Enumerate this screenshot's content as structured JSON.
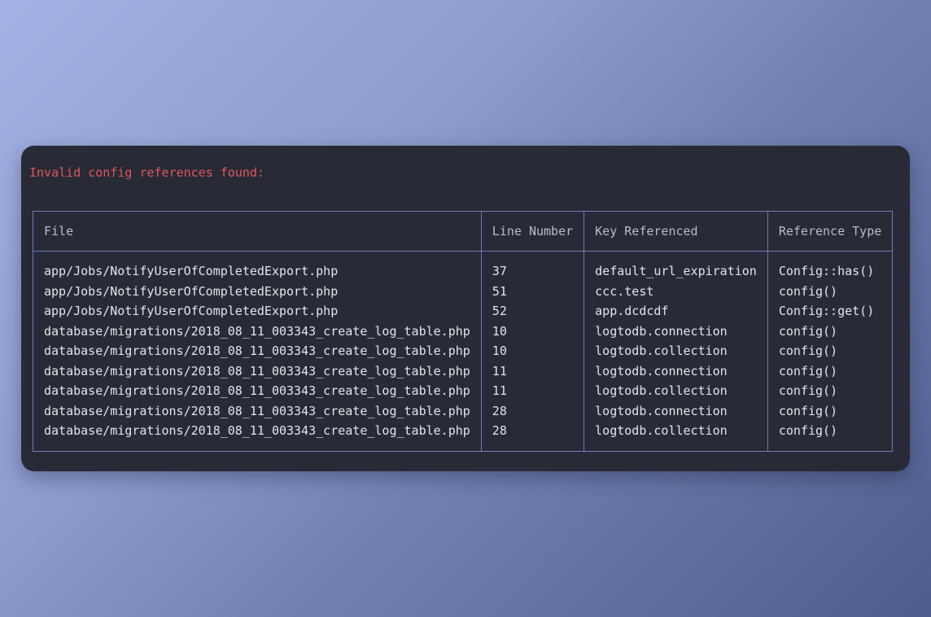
{
  "terminal": {
    "error_message": "Invalid config references found:",
    "table": {
      "headers": [
        "File",
        "Line Number",
        "Key Referenced",
        "Reference Type"
      ],
      "rows": [
        [
          "app/Jobs/NotifyUserOfCompletedExport.php",
          "37",
          "default_url_expiration",
          "Config::has()"
        ],
        [
          "app/Jobs/NotifyUserOfCompletedExport.php",
          "51",
          "ccc.test",
          "config()"
        ],
        [
          "app/Jobs/NotifyUserOfCompletedExport.php",
          "52",
          "app.dcdcdf",
          "Config::get()"
        ],
        [
          "database/migrations/2018_08_11_003343_create_log_table.php",
          "10",
          "logtodb.connection",
          "config()"
        ],
        [
          "database/migrations/2018_08_11_003343_create_log_table.php",
          "10",
          "logtodb.collection",
          "config()"
        ],
        [
          "database/migrations/2018_08_11_003343_create_log_table.php",
          "11",
          "logtodb.connection",
          "config()"
        ],
        [
          "database/migrations/2018_08_11_003343_create_log_table.php",
          "11",
          "logtodb.collection",
          "config()"
        ],
        [
          "database/migrations/2018_08_11_003343_create_log_table.php",
          "28",
          "logtodb.connection",
          "config()"
        ],
        [
          "database/migrations/2018_08_11_003343_create_log_table.php",
          "28",
          "logtodb.collection",
          "config()"
        ]
      ]
    }
  },
  "colors": {
    "error_text": "#e0575b",
    "terminal_bg": "#282a35",
    "table_border": "#6d7cbf",
    "cell_text": "#e3e5ee",
    "header_text": "#b9bccb"
  }
}
